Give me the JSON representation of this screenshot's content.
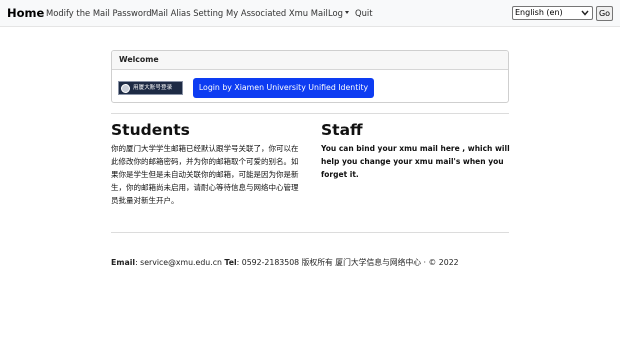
{
  "navbar": {
    "brand": "Home",
    "items": [
      {
        "label": "Modify the Mail Password"
      },
      {
        "label": "Mail Alias Setting"
      },
      {
        "label": "My Associated Xmu Mail"
      },
      {
        "label": "Log"
      },
      {
        "label": "Quit"
      }
    ],
    "language": {
      "selected": "English (en)",
      "go_label": "Go"
    }
  },
  "welcome": {
    "header": "Welcome",
    "badge_text": "用厦大账号登录",
    "login_button": "Login by Xiamen University Unified Identity"
  },
  "students": {
    "title": "Students",
    "body": "你的厦门大学学生邮箱已经默认跟学号关联了，你可以在此修改你的邮箱密码，并为你的邮箱取个可爱的别名。如果你是学生但是未自动关联你的邮箱，可能是因为你是新生，你的邮箱尚未启用，请耐心等待信息与网络中心管理员批量对新生开户。"
  },
  "staff": {
    "title": "Staff",
    "body": "You can bind your xmu mail here , which will help you change your xmu mail's when you forget it."
  },
  "footer": {
    "email_label": "Email",
    "email": "service@xmu.edu.cn",
    "tel_label": "Tel",
    "tel": "0592-2183508",
    "copyright": "版权所有 厦门大学信息与网络中心 · © 2022"
  },
  "colors": {
    "navbar_bg": "#f8f9fa",
    "login_button_bg": "#0d3cf2",
    "badge_bg": "#1d2a44"
  }
}
